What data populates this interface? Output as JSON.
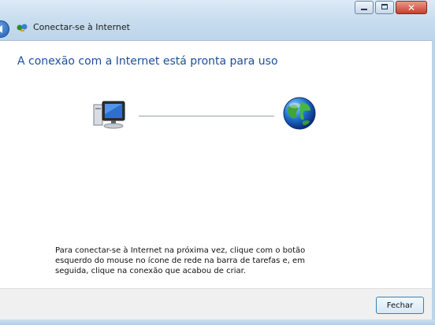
{
  "window": {
    "title": "Conectar-se à Internet",
    "controls": {
      "minimize_icon": "minimize-icon",
      "maximize_icon": "maximize-icon",
      "close_label": "✕"
    }
  },
  "content": {
    "heading": "A conexão com a Internet está pronta para uso",
    "instructions": [
      "Para conectar-se à Internet na próxima vez, clique com o botão",
      "esquerdo do mouse no ícone de rede na barra de tarefas e, em",
      "seguida, clique na conexão que acabou de criar."
    ]
  },
  "footer": {
    "close_button_label": "Fechar"
  },
  "colors": {
    "heading": "#1e4e9a",
    "chrome_top": "#dcebf7",
    "chrome_bottom": "#bdd5ea",
    "close_red": "#c7402c"
  },
  "icons": {
    "back": "back-arrow-icon",
    "title": "network-icon",
    "computer": "computer-icon",
    "globe": "globe-icon"
  }
}
